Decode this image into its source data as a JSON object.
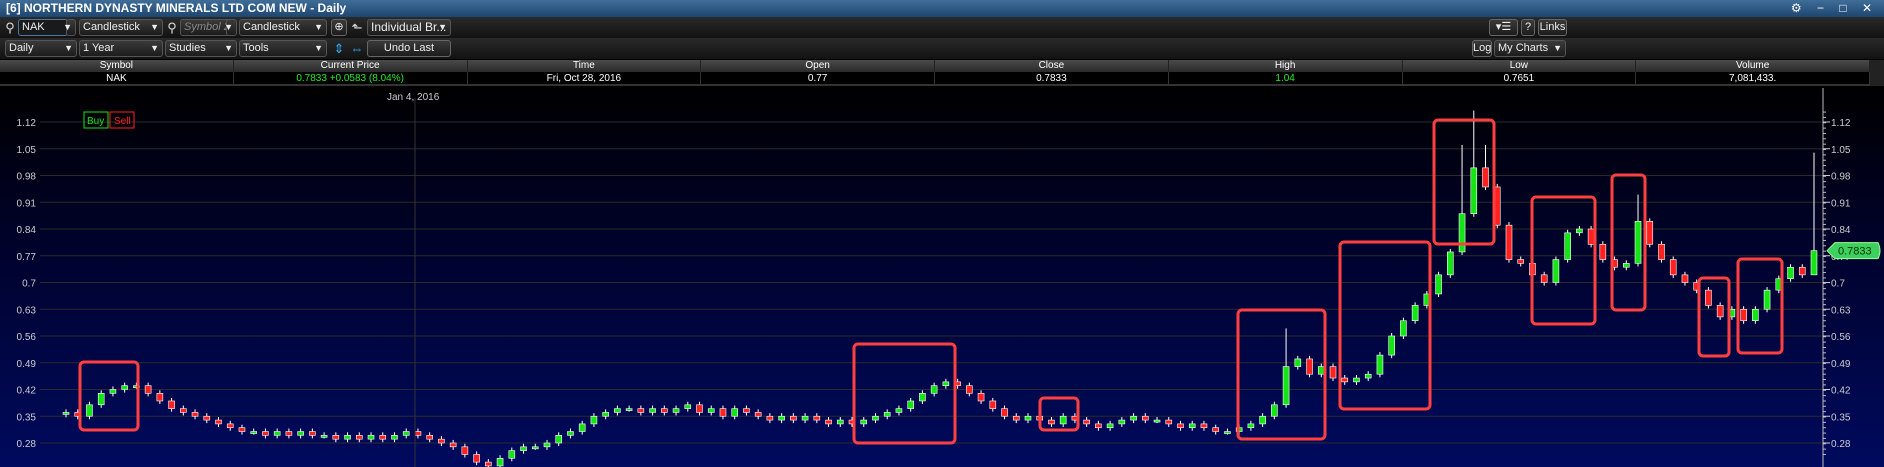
{
  "window": {
    "title": "[6] NORTHERN DYNASTY MINERALS LTD COM NEW - Daily",
    "controls": "⚙ − □ ✕"
  },
  "toolbar": {
    "symbol": "NAK",
    "chart_type": "Candlestick",
    "symbol2_placeholder": "Symbol 2",
    "chart_type2": "Candlestick",
    "layout": "Individual Br...",
    "interval": "Daily",
    "range": "1 Year",
    "studies": "Studies",
    "tools": "Tools",
    "undo": "Undo Last",
    "help": "?",
    "links": "Links",
    "log": "Log",
    "my_charts": "My Charts"
  },
  "quote": {
    "headers": [
      "Symbol",
      "Current Price",
      "Time",
      "Open",
      "Close",
      "High",
      "Low",
      "Volume"
    ],
    "values": [
      "NAK",
      "0.7833  +0.0583 (8.04%)",
      "Fri, Oct 28, 2016",
      "0.77",
      "0.7833",
      "1.04",
      "0.7651",
      "7,081,433."
    ]
  },
  "chart_data": {
    "type": "candlestick",
    "date_marker": "Jan 4, 2016",
    "buy_label": "Buy",
    "sell_label": "Sell",
    "current_price": "0.7833",
    "y_ticks": [
      1.12,
      1.05,
      0.98,
      0.91,
      0.84,
      0.77,
      0.7,
      0.63,
      0.56,
      0.49,
      0.42,
      0.35,
      0.28
    ],
    "closes": [
      0.36,
      0.35,
      0.38,
      0.41,
      0.42,
      0.43,
      0.43,
      0.41,
      0.39,
      0.37,
      0.36,
      0.35,
      0.34,
      0.33,
      0.32,
      0.31,
      0.31,
      0.3,
      0.31,
      0.3,
      0.31,
      0.3,
      0.3,
      0.29,
      0.3,
      0.29,
      0.3,
      0.29,
      0.3,
      0.31,
      0.3,
      0.29,
      0.28,
      0.27,
      0.25,
      0.23,
      0.22,
      0.24,
      0.26,
      0.27,
      0.27,
      0.28,
      0.3,
      0.31,
      0.33,
      0.35,
      0.36,
      0.37,
      0.37,
      0.36,
      0.37,
      0.36,
      0.37,
      0.38,
      0.36,
      0.37,
      0.35,
      0.37,
      0.36,
      0.35,
      0.34,
      0.35,
      0.34,
      0.35,
      0.34,
      0.33,
      0.34,
      0.33,
      0.34,
      0.35,
      0.36,
      0.37,
      0.39,
      0.41,
      0.43,
      0.44,
      0.43,
      0.41,
      0.39,
      0.37,
      0.35,
      0.34,
      0.35,
      0.34,
      0.33,
      0.35,
      0.34,
      0.33,
      0.32,
      0.33,
      0.34,
      0.35,
      0.34,
      0.34,
      0.33,
      0.32,
      0.33,
      0.32,
      0.31,
      0.31,
      0.32,
      0.33,
      0.35,
      0.38,
      0.48,
      0.5,
      0.46,
      0.48,
      0.45,
      0.44,
      0.45,
      0.46,
      0.51,
      0.56,
      0.6,
      0.64,
      0.67,
      0.72,
      0.78,
      0.88,
      1.0,
      0.95,
      0.85,
      0.76,
      0.75,
      0.72,
      0.7,
      0.76,
      0.83,
      0.84,
      0.8,
      0.76,
      0.74,
      0.75,
      0.86,
      0.8,
      0.76,
      0.72,
      0.7,
      0.68,
      0.64,
      0.61,
      0.63,
      0.6,
      0.63,
      0.68,
      0.71,
      0.74,
      0.72,
      0.7833
    ],
    "high_overrides": {
      "104": 0.58,
      "119": 1.06,
      "120": 1.15,
      "121": 1.06,
      "134": 0.93,
      "149": 1.04
    },
    "low_overrides": {
      "149": 0.7651
    },
    "colors": {
      "up": "#14e614",
      "down": "#ff2020",
      "box": "#ff4040",
      "tag": "#3fcf5f"
    }
  }
}
